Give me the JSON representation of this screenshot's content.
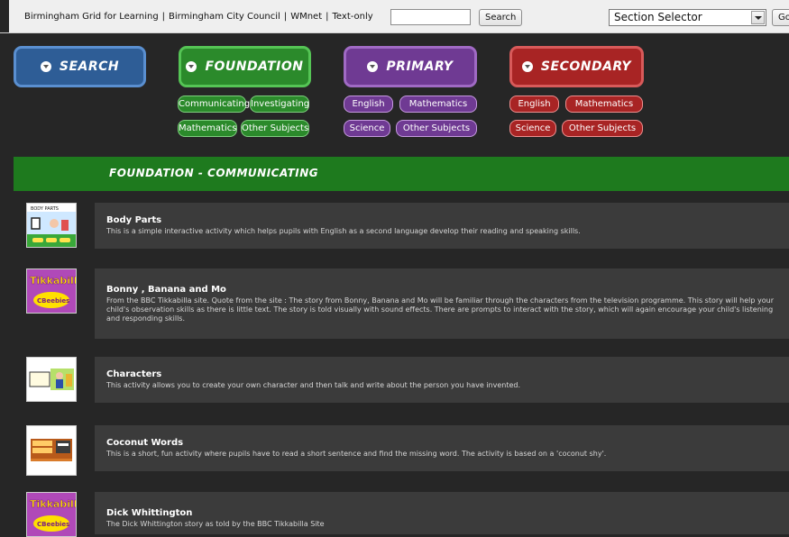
{
  "top": {
    "links": [
      "Birmingham Grid for Learning",
      "Birmingham City Council",
      "WMnet",
      "Text-only"
    ],
    "separator": "|",
    "search_button": "Search",
    "section_selector": "Section Selector",
    "go_button": "Go"
  },
  "nav": {
    "search": "SEARCH",
    "foundation": "FOUNDATION",
    "primary": "PRIMARY",
    "secondary": "SECONDARY",
    "foundation_subjects": [
      "Communicating",
      "Investigating",
      "Mathematics",
      "Other Subjects"
    ],
    "primary_subjects": [
      "English",
      "Mathematics",
      "Science",
      "Other Subjects"
    ],
    "secondary_subjects": [
      "English",
      "Mathematics",
      "Science",
      "Other Subjects"
    ]
  },
  "section": {
    "title": "FOUNDATION - COMMUNICATING"
  },
  "items": [
    {
      "title": "Body Parts",
      "desc": "This is a simple interactive activity which helps pupils with English as a second language develop their reading and speaking skills."
    },
    {
      "title": "Bonny , Banana and Mo",
      "desc": "From the BBC Tikkabilla site. Quote from the site : The story from Bonny, Banana and Mo will be familiar through the characters from the television programme. This story will help your child's observation skills as there is little text. The story is told visually with sound effects. There are prompts to interact with the story, which will again encourage your child's listening and responding skills."
    },
    {
      "title": "Characters",
      "desc": "This activity allows you to create your own character and then talk and write about the person you have invented."
    },
    {
      "title": "Coconut Words",
      "desc": "This is a short, fun activity where pupils have to read a short sentence and find the missing word. The activity is based on a 'coconut shy'."
    },
    {
      "title": "Dick Whittington",
      "desc": "The Dick Whittington story as told by the BBC Tikkabilla Site"
    }
  ],
  "thumbs": {
    "tikkabilla": "Tikkabilla",
    "cbeebies": "CBeebies",
    "body_parts": "BODY PARTS"
  },
  "colors": {
    "foundation": "#2b8a2b",
    "primary": "#6f3a93",
    "secondary": "#a82424",
    "search": "#2e5d96"
  }
}
